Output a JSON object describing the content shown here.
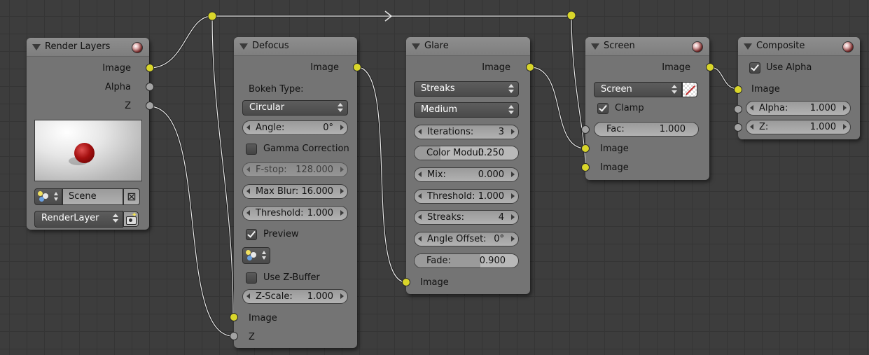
{
  "nodes": {
    "render_layers": {
      "title": "Render Layers",
      "outputs": [
        "Image",
        "Alpha",
        "Z"
      ],
      "scene_value": "Scene",
      "layer_value": "RenderLayer",
      "preview_icon": "sphere-preview-thumbnail"
    },
    "defocus": {
      "title": "Defocus",
      "output": "Image",
      "bokeh_label": "Bokeh Type:",
      "bokeh_value": "Circular",
      "angle_label": "Angle:",
      "angle_value": "0°",
      "gamma_label": "Gamma Correction",
      "gamma_checked": false,
      "fstop_label": "F-stop:",
      "fstop_value": "128.000",
      "maxblur_label": "Max Blur:",
      "maxblur_value": "16.000",
      "threshold_label": "Threshold:",
      "threshold_value": "1.000",
      "preview_label": "Preview",
      "preview_checked": true,
      "zbuffer_label": "Use Z-Buffer",
      "zbuffer_checked": false,
      "zscale_label": "Z-Scale:",
      "zscale_value": "1.000",
      "inputs": [
        "Image",
        "Z"
      ]
    },
    "glare": {
      "title": "Glare",
      "output": "Image",
      "type_value": "Streaks",
      "quality_value": "Medium",
      "iterations_label": "Iterations:",
      "iterations_value": "3",
      "colormod_label": "Color Modul:",
      "colormod_value": "0.250",
      "mix_label": "Mix:",
      "mix_value": "0.000",
      "threshold_label": "Threshold:",
      "threshold_value": "1.000",
      "streaks_label": "Streaks:",
      "streaks_value": "4",
      "angleoffset_label": "Angle Offset:",
      "angleoffset_value": "0°",
      "fade_label": "Fade:",
      "fade_value": "0.900",
      "input": "Image"
    },
    "screen": {
      "title": "Screen",
      "output": "Image",
      "blend_value": "Screen",
      "clamp_label": "Clamp",
      "clamp_checked": true,
      "fac_label": "Fac:",
      "fac_value": "1.000",
      "inputs": [
        "Image",
        "Image"
      ]
    },
    "composite": {
      "title": "Composite",
      "use_alpha_label": "Use Alpha",
      "use_alpha_checked": true,
      "input": "Image",
      "alpha_label": "Alpha:",
      "alpha_value": "1.000",
      "z_label": "Z:",
      "z_value": "1.000"
    }
  },
  "colors": {
    "background": "#3d3d3d",
    "node_body": "#747474",
    "socket_image": "#d9d62a",
    "socket_value": "#a3a3a3",
    "wire": "#1e1e1e"
  }
}
